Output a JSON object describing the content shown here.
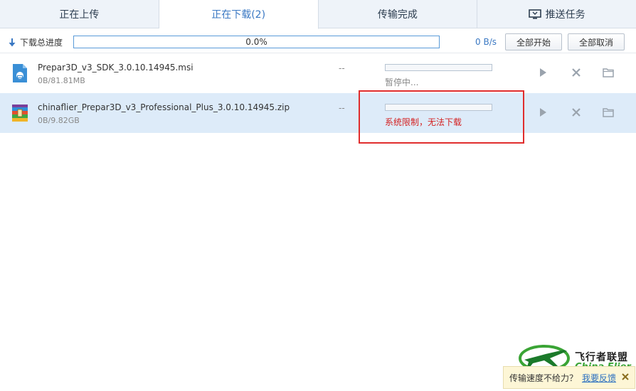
{
  "tabs": [
    {
      "label": "正在上传"
    },
    {
      "label": "正在下载(2)"
    },
    {
      "label": "传输完成"
    },
    {
      "label": "推送任务"
    }
  ],
  "total": {
    "label": "下载总进度",
    "percent_text": "0.0%",
    "progress": 0.0,
    "speed": "0 B/s",
    "start_all": "全部开始",
    "cancel_all": "全部取消"
  },
  "files": [
    {
      "name": "Prepar3D_v3_SDK_3.0.10.14945.msi",
      "size": "0B/81.81MB",
      "speed": "--",
      "progress": 0.0,
      "status": "暂停中...",
      "icon": "msi-installer-icon"
    },
    {
      "name": "chinaflier_Prepar3D_v3_Professional_Plus_3.0.10.14945.zip",
      "size": "0B/9.82GB",
      "speed": "--",
      "progress": 0.0,
      "status": "系统限制，无法下载",
      "icon": "zip-archive-icon"
    }
  ],
  "watermark": {
    "title": "飞行者联盟",
    "subtitle": "China Flier"
  },
  "feedback": {
    "text": "传输速度不给力？",
    "link": "我要反馈"
  },
  "colors": {
    "accent": "#3a78c3",
    "error": "#d42121",
    "selected_row": "#ddebf9",
    "highlight_box": "#e02d2d"
  }
}
